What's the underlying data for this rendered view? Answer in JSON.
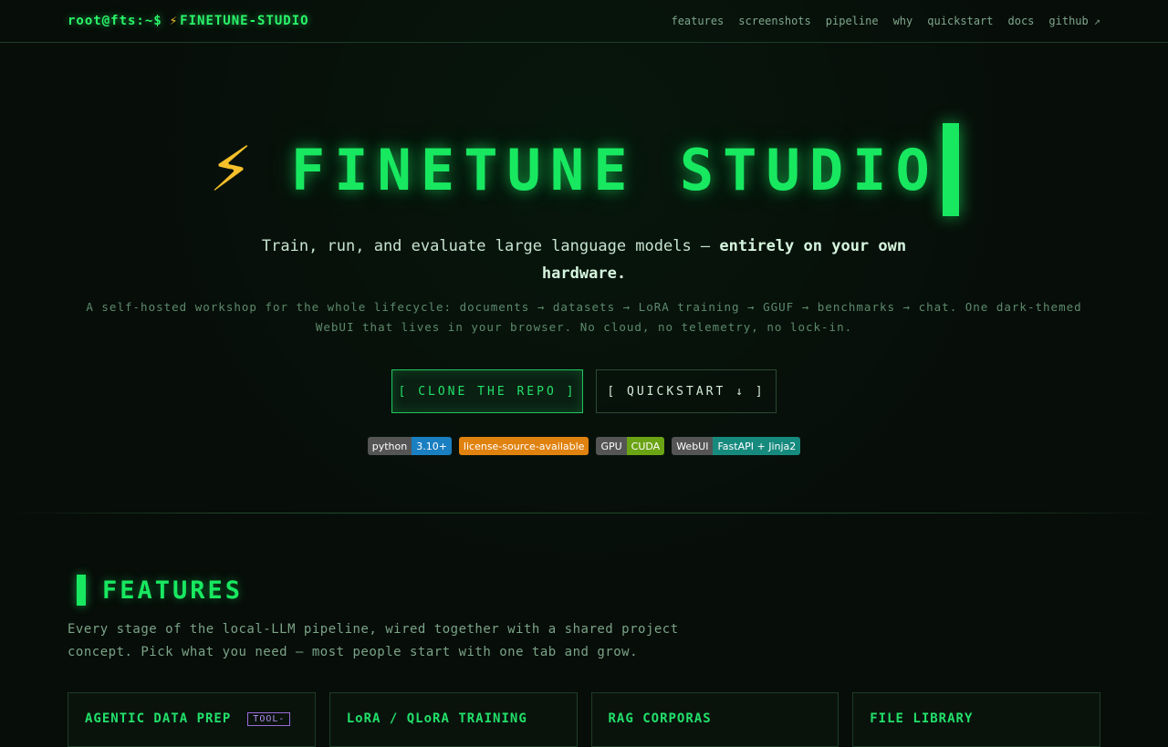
{
  "nav": {
    "prompt": "root@fts:~$",
    "brand_icon": "⚡",
    "brand_name": "FINETUNE-STUDIO",
    "links": [
      "features",
      "screenshots",
      "pipeline",
      "why",
      "quickstart",
      "docs",
      "github"
    ],
    "github_external_glyph": "↗"
  },
  "hero": {
    "icon": "⚡",
    "title": "FINETUNE STUDIO",
    "tagline_plain": "Train, run, and evaluate large language models — ",
    "tagline_bold": "entirely on your own hardware",
    "tagline_end": ".",
    "subline": "A self-hosted workshop for the whole lifecycle: documents → datasets → LoRA training → GGUF → benchmarks → chat. One dark-themed WebUI that lives in your browser. No cloud, no telemetry, no lock-in.",
    "primary_button": "[ CLONE THE REPO ]",
    "secondary_button": "[ QUICKSTART ↓ ]"
  },
  "badges": [
    {
      "left": "python",
      "right": "3.10+",
      "color": "#1a7fc1"
    },
    {
      "left": "",
      "right": "license-source-available",
      "color": "#e0820f"
    },
    {
      "left": "GPU",
      "right": "CUDA",
      "color": "#6aa313"
    },
    {
      "left": "WebUI",
      "right": "FastAPI + Jinja2",
      "color": "#178a7e"
    }
  ],
  "features": {
    "heading": "FEATURES",
    "description": "Every stage of the local-LLM pipeline, wired together with a shared project concept. Pick what you need — most people start with one tab and grow.",
    "cards": [
      {
        "title": "AGENTIC DATA PREP",
        "tag": "TOOL-"
      },
      {
        "title": "LoRA / QLoRA TRAINING",
        "tag": ""
      },
      {
        "title": "RAG CORPORAS",
        "tag": ""
      },
      {
        "title": "FILE LIBRARY",
        "tag": ""
      }
    ]
  },
  "colors": {
    "accent": "#18e860",
    "background": "#070d09",
    "bolt": "#f5c02a"
  }
}
